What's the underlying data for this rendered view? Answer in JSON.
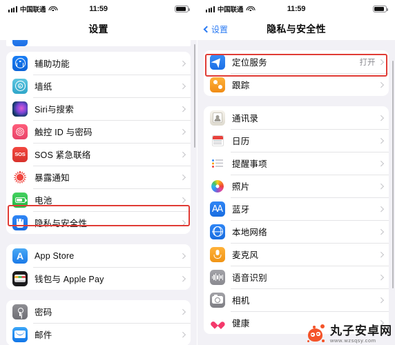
{
  "status_bar": {
    "carrier": "中国联通",
    "time": "11:59",
    "signal_icon": "signal-bars-icon",
    "wifi_icon": "wifi-icon",
    "battery_icon": "battery-icon"
  },
  "left_screen": {
    "nav": {
      "title": "设置"
    },
    "groups": [
      {
        "rows": [
          {
            "label": "辅助功能",
            "icon": "accessibility-icon"
          },
          {
            "label": "墙纸",
            "icon": "wallpaper-icon"
          },
          {
            "label": "Siri与搜索",
            "icon": "siri-icon"
          },
          {
            "label": "触控 ID 与密码",
            "icon": "touchid-icon"
          },
          {
            "label": "SOS 紧急联络",
            "icon": "sos-icon",
            "badge": "SOS"
          },
          {
            "label": "暴露通知",
            "icon": "exposure-notification-icon"
          },
          {
            "label": "电池",
            "icon": "battery-settings-icon"
          },
          {
            "label": "隐私与安全性",
            "icon": "privacy-hand-icon",
            "highlighted": true
          }
        ]
      },
      {
        "rows": [
          {
            "label": "App Store",
            "icon": "app-store-icon"
          },
          {
            "label": "钱包与 Apple Pay",
            "icon": "wallet-icon"
          }
        ]
      },
      {
        "rows": [
          {
            "label": "密码",
            "icon": "passwords-key-icon"
          },
          {
            "label": "邮件",
            "icon": "mail-icon"
          }
        ]
      }
    ]
  },
  "right_screen": {
    "nav": {
      "back_label": "设置",
      "back_icon": "chevron-left-icon",
      "title": "隐私与安全性"
    },
    "groups": [
      {
        "rows": [
          {
            "label": "定位服务",
            "icon": "location-services-icon",
            "value": "打开",
            "highlighted": true
          },
          {
            "label": "跟踪",
            "icon": "tracking-icon"
          }
        ]
      },
      {
        "rows": [
          {
            "label": "通讯录",
            "icon": "contacts-icon"
          },
          {
            "label": "日历",
            "icon": "calendar-icon"
          },
          {
            "label": "提醒事项",
            "icon": "reminders-icon"
          },
          {
            "label": "照片",
            "icon": "photos-icon"
          },
          {
            "label": "蓝牙",
            "icon": "bluetooth-icon"
          },
          {
            "label": "本地网络",
            "icon": "local-network-icon"
          },
          {
            "label": "麦克风",
            "icon": "microphone-icon"
          },
          {
            "label": "语音识别",
            "icon": "speech-recognition-icon"
          },
          {
            "label": "相机",
            "icon": "camera-icon"
          },
          {
            "label": "健康",
            "icon": "health-icon"
          }
        ]
      }
    ]
  },
  "watermark": {
    "name": "丸子安卓网",
    "url": "www.wzsqsy.com",
    "mascot_icon": "mascot-icon"
  },
  "colors": {
    "highlight_box": "#e03b35",
    "accent_blue": "#2b7bf3",
    "page_background": "#f2f1f6",
    "card_background": "#ffffff",
    "secondary_text": "#8d8d93"
  }
}
